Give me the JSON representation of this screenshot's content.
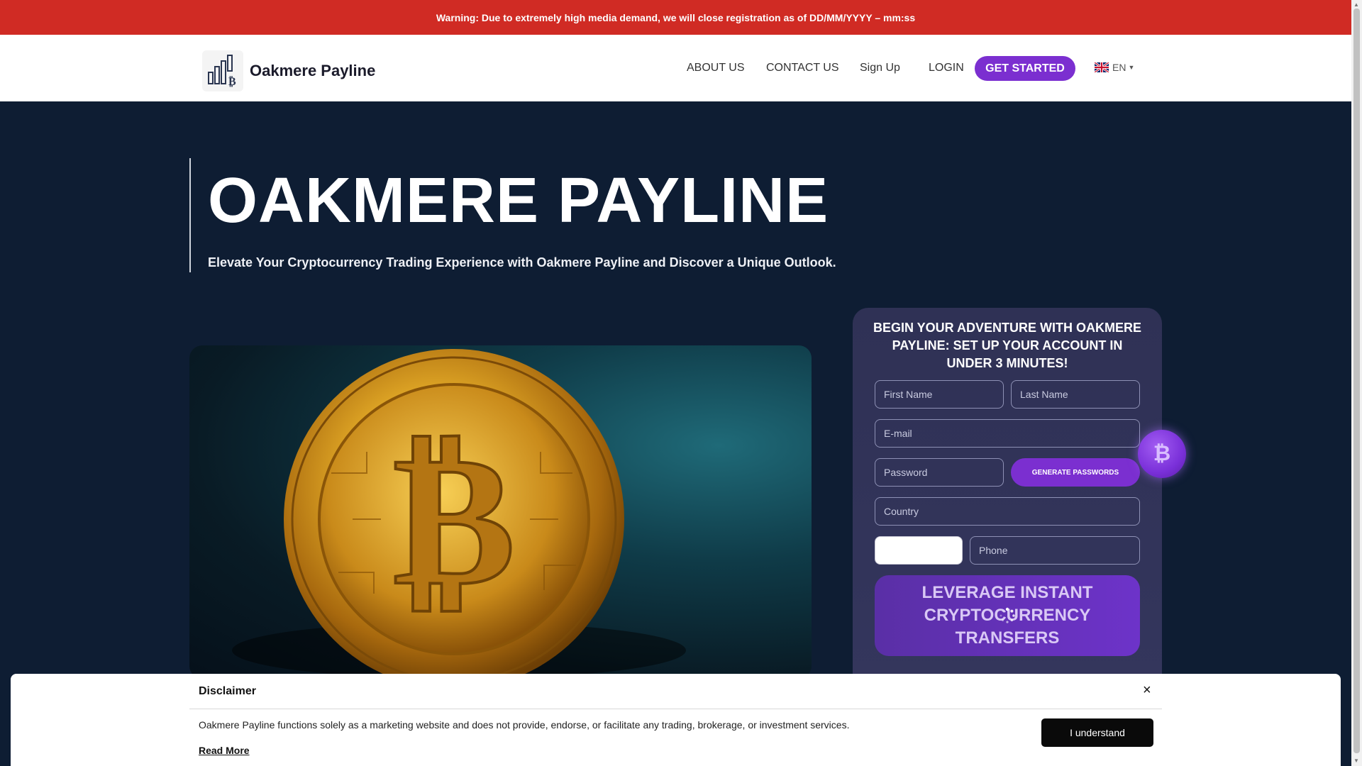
{
  "warning": {
    "text": "Warning: Due to extremely high media demand, we will close registration as of DD/MM/YYYY – mm:ss"
  },
  "header": {
    "brand": "Oakmere Payline",
    "nav": {
      "about": "ABOUT US",
      "contact": "CONTACT US",
      "signup": "Sign Up",
      "login": "LOGIN",
      "get_started": "GET STARTED",
      "language": "EN"
    }
  },
  "hero": {
    "title": "OAKMERE PAYLINE",
    "subtitle": "Elevate Your Cryptocurrency Trading Experience with Oakmere Payline and Discover a Unique Outlook."
  },
  "form": {
    "title": "BEGIN YOUR ADVENTURE WITH OAKMERE PAYLINE: SET UP YOUR ACCOUNT IN UNDER 3 MINUTES!",
    "first_name": "First Name",
    "last_name": "Last Name",
    "email": "E-mail",
    "password": "Password",
    "generate": "GENERATE PASSWORDS",
    "country": "Country",
    "phone": "Phone",
    "submit": "LEVERAGE INSTANT CRYPTOCURRENCY TRANSFERS"
  },
  "disclaimer": {
    "title": "Disclaimer",
    "close": "×",
    "text": "Oakmere Payline functions solely as a marketing website and does not provide, endorse, or facilitate any trading, brokerage, or investment services.",
    "read_more": "Read More",
    "button": "I understand"
  },
  "colors": {
    "warning": "#d02b24",
    "accent": "#7b2fd0",
    "hero_bg": "#0e1d33",
    "form_card": "#2f3155"
  },
  "icons": {
    "logo": "bitcoin-chart-logo-icon",
    "flag": "uk-flag-icon",
    "coin": "bitcoin-coin-icon",
    "spinner": "loading-spinner-icon"
  }
}
